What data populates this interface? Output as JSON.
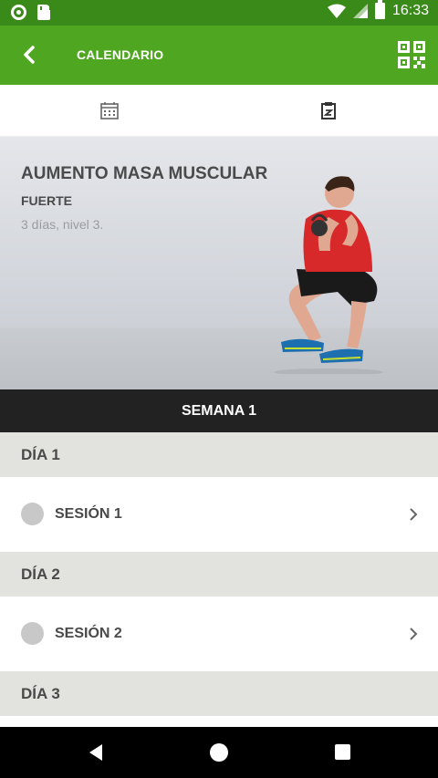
{
  "status_bar": {
    "time": "16:33"
  },
  "app_bar": {
    "title": "CALENDARIO"
  },
  "program": {
    "title": "AUMENTO MASA MUSCULAR",
    "level": "FUERTE",
    "description": "3 días, nivel 3."
  },
  "week": {
    "label": "SEMANA 1"
  },
  "days": [
    {
      "label": "DÍA 1",
      "session": "SESIÓN 1"
    },
    {
      "label": "DÍA 2",
      "session": "SESIÓN 2"
    },
    {
      "label": "DÍA 3"
    }
  ],
  "colors": {
    "status_bar": "#3a8a1a",
    "app_bar": "#4fa621",
    "week_header": "#222222",
    "day_header": "#e2e2de"
  },
  "icons": [
    "back-icon",
    "qr-code-icon",
    "calendar-icon",
    "clipboard-icon",
    "chevron-right-icon"
  ]
}
